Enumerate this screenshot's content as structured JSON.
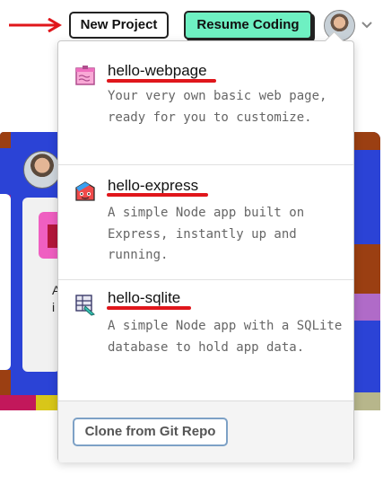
{
  "header": {
    "new_project_label": "New Project",
    "resume_coding_label": "Resume Coding",
    "user_menu_icon": "chevron-down-icon"
  },
  "dropdown": {
    "items": [
      {
        "title": "hello-webpage",
        "description": "Your very own basic web page, ready for you to customize.",
        "icon": "webpage-icon"
      },
      {
        "title": "hello-express",
        "description": "A simple Node app built on Express, instantly up and running.",
        "icon": "express-icon"
      },
      {
        "title": "hello-sqlite",
        "description": "A simple Node app with a SQLite database to hold app data.",
        "icon": "sqlite-icon"
      }
    ],
    "clone_label": "Clone from Git Repo"
  },
  "background": {
    "card_text_fragments": [
      "A",
      "i"
    ]
  },
  "colors": {
    "resume_bg": "#6ef0c2",
    "annotation_red": "#e0161b",
    "clone_border": "#7da1c6"
  }
}
